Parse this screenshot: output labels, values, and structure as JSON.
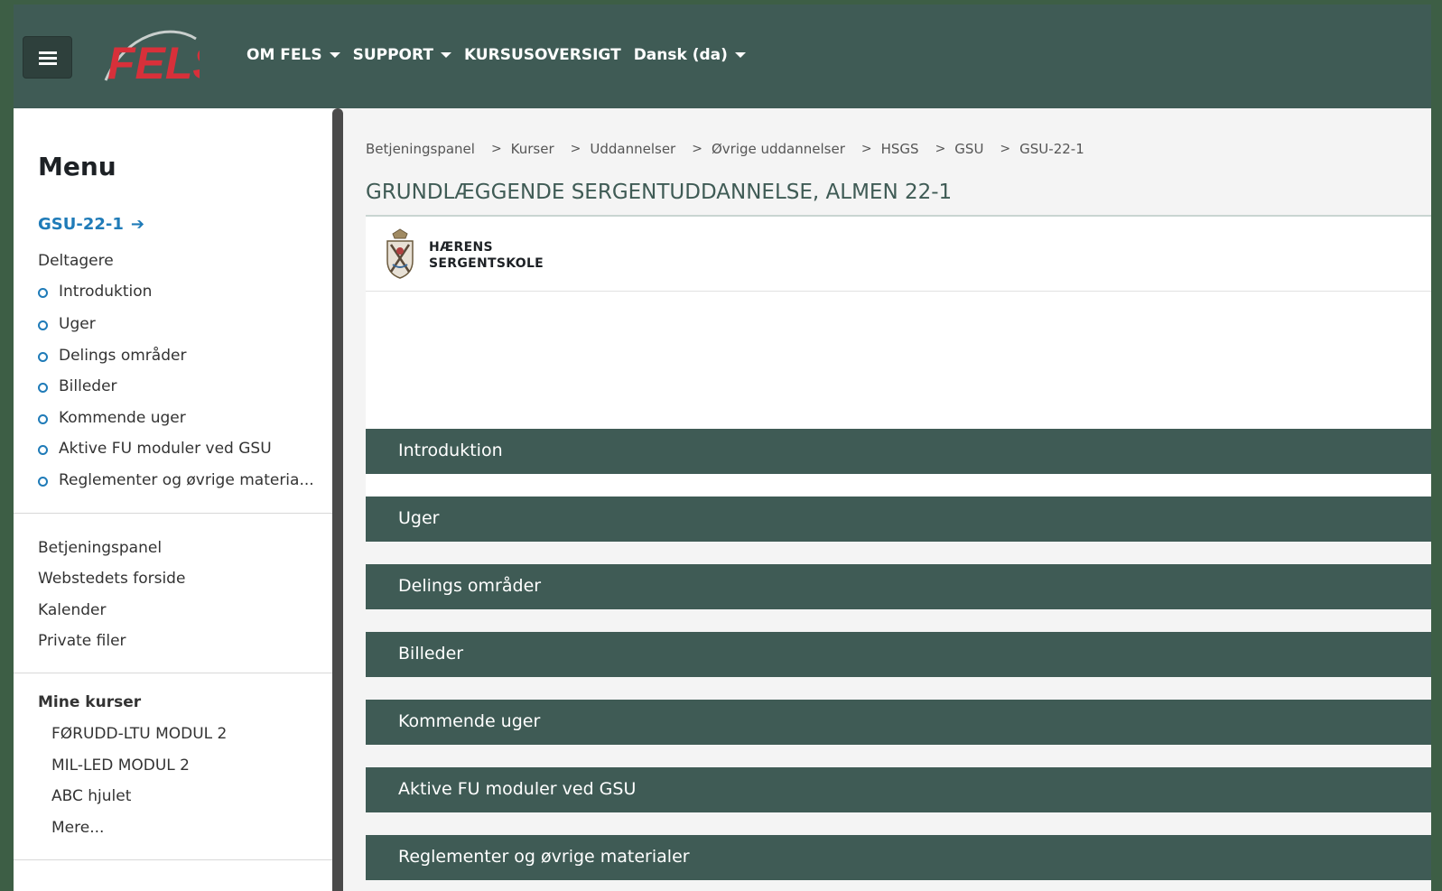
{
  "navbar": {
    "logo_text": "FELS",
    "items": [
      {
        "label": "OM FELS",
        "dropdown": true
      },
      {
        "label": "SUPPORT",
        "dropdown": true
      },
      {
        "label": "KURSUSOVERSIGT",
        "dropdown": false
      },
      {
        "label": "Dansk (da)",
        "dropdown": true
      }
    ]
  },
  "drawer": {
    "title": "Menu",
    "course_link": "GSU-22-1",
    "participants": "Deltagere",
    "sections": [
      "Introduktion",
      "Uger",
      "Delings områder",
      "Billeder",
      "Kommende uger",
      "Aktive FU moduler ved GSU",
      "Reglementer og øvrige materia..."
    ],
    "site_links": [
      "Betjeningspanel",
      "Webstedets forside",
      "Kalender",
      "Private filer"
    ],
    "my_courses_title": "Mine kurser",
    "my_courses": [
      "FØRUDD-LTU MODUL 2",
      "MIL-LED MODUL 2",
      "ABC hjulet",
      "Mere..."
    ]
  },
  "main": {
    "breadcrumb": [
      "Betjeningspanel",
      "Kurser",
      "Uddannelser",
      "Øvrige uddannelser",
      "HSGS",
      "GSU",
      "GSU-22-1"
    ],
    "page_title": "GRUNDLÆGGENDE SERGENTUDDANNELSE, ALMEN 22-1",
    "school_name_line1": "HÆRENS",
    "school_name_line2": "SERGENTSKOLE",
    "sections": [
      "Introduktion",
      "Uger",
      "Delings områder",
      "Billeder",
      "Kommende uger",
      "Aktive FU moduler ved GSU",
      "Reglementer og øvrige materialer"
    ]
  },
  "colors": {
    "navbar": "#3f5b55",
    "accent_link": "#1f7bb8",
    "logo_red": "#d8303a",
    "section_bar": "#3f5b55"
  }
}
